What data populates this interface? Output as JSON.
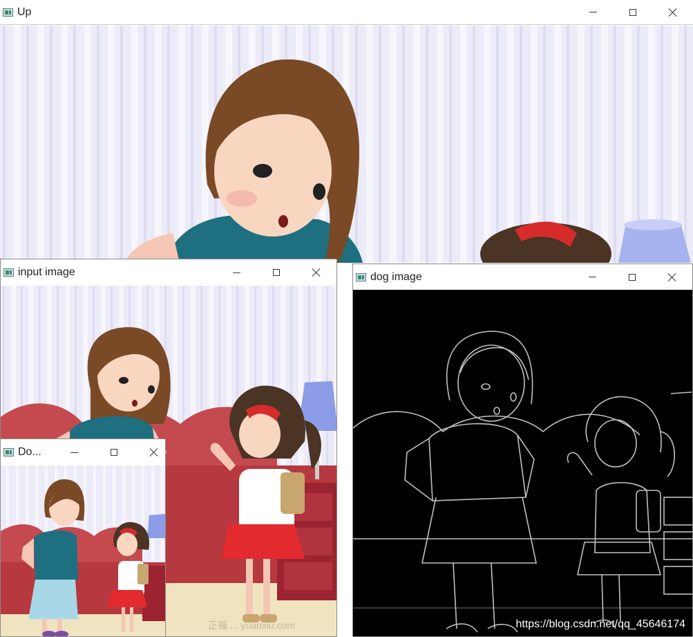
{
  "windows": {
    "up": {
      "title": "Up"
    },
    "input": {
      "title": "input image"
    },
    "dog": {
      "title": "dog image"
    },
    "down": {
      "title": "Do..."
    }
  },
  "watermark": "https://blog.csdn.net/qq_45646174",
  "faint_watermark": "正福 ... yuanxiu.com",
  "icons": {
    "minimize": "minimize-icon",
    "maximize": "maximize-icon",
    "close": "close-icon",
    "app": "opencv-window-icon"
  },
  "colors": {
    "title_bar": "#ffffff",
    "dog_background": "#000000",
    "curtain": "#e9e8f8",
    "sofa": "#c44a4f"
  }
}
